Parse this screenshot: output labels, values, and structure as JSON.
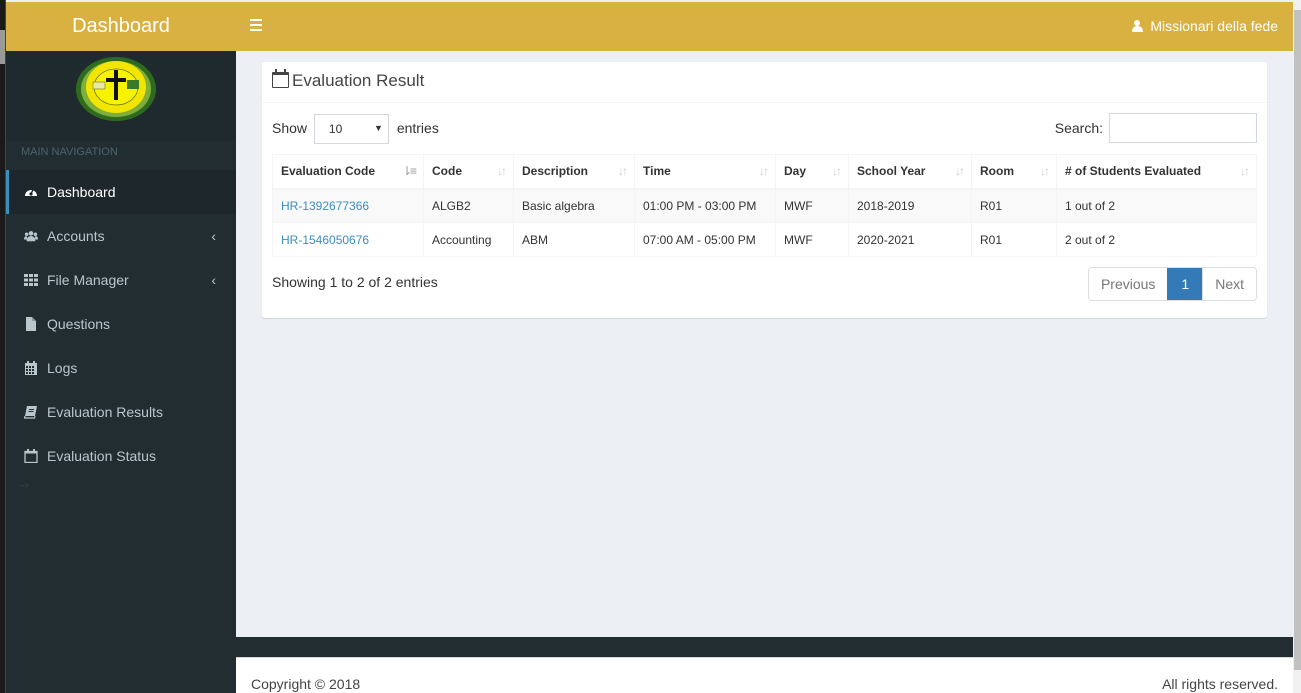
{
  "header": {
    "brand": "Dashboard",
    "menu_toggle_icon": "hamburger-icon",
    "user_icon": "user-icon",
    "user_name": "Missionari della fede",
    "color": "#d8b141"
  },
  "sidebar": {
    "logo_alt": "Missionari della fede logo",
    "nav_header": "MAIN NAVIGATION",
    "items": [
      {
        "label": "Dashboard",
        "icon": "dashboard-gauge-icon",
        "active": true,
        "has_children": false
      },
      {
        "label": "Accounts",
        "icon": "users-icon",
        "active": false,
        "has_children": true
      },
      {
        "label": "File Manager",
        "icon": "grid-icon",
        "active": false,
        "has_children": true
      },
      {
        "label": "Questions",
        "icon": "file-icon",
        "active": false,
        "has_children": false
      },
      {
        "label": "Logs",
        "icon": "calendar-icon",
        "active": false,
        "has_children": false
      },
      {
        "label": "Evaluation Results",
        "icon": "book-icon",
        "active": false,
        "has_children": false
      },
      {
        "label": "Evaluation Status",
        "icon": "calendar-o-icon",
        "active": false,
        "has_children": false
      }
    ],
    "stray_text": "-->",
    "chevron": "‹"
  },
  "box": {
    "title": "Evaluation Result",
    "title_icon": "calendar-o-icon",
    "length": {
      "prefix": "Show",
      "value": "10",
      "suffix": "entries"
    },
    "search": {
      "label": "Search:",
      "value": "",
      "placeholder": ""
    },
    "table": {
      "columns": [
        "Evaluation Code",
        "Code",
        "Description",
        "Time",
        "Day",
        "School Year",
        "Room",
        "# of Students Evaluated"
      ],
      "sorted_column": 0,
      "rows": [
        [
          "HR-1392677366",
          "ALGB2",
          "Basic algebra",
          "01:00 PM - 03:00 PM",
          "MWF",
          "2018-2019",
          "R01",
          "1 out of 2"
        ],
        [
          "HR-1546050676",
          "Accounting",
          "ABM",
          "07:00 AM - 05:00 PM",
          "MWF",
          "2020-2021",
          "R01",
          "2 out of 2"
        ]
      ]
    },
    "info": "Showing 1 to 2 of 2 entries",
    "pagination": {
      "previous": "Previous",
      "current": "1",
      "next": "Next"
    }
  },
  "footer": {
    "copyright": "Copyright © 2018",
    "rights": "All rights reserved."
  }
}
